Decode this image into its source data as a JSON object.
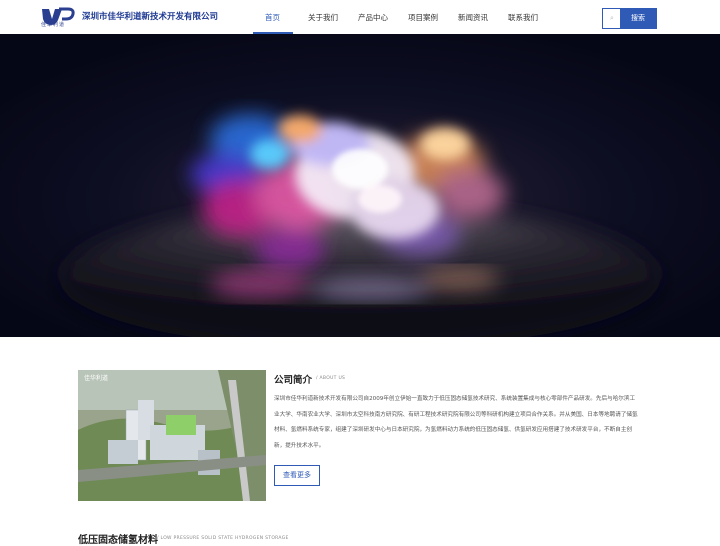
{
  "header": {
    "logo_text": "佳华利道",
    "company_name": "深圳市佳华利道新技术开发有限公司"
  },
  "nav": {
    "items": [
      {
        "label": "首页",
        "active": true
      },
      {
        "label": "关于我们",
        "active": false
      },
      {
        "label": "产品中心",
        "active": false
      },
      {
        "label": "项目案例",
        "active": false
      },
      {
        "label": "新闻资讯",
        "active": false
      },
      {
        "label": "联系我们",
        "active": false
      }
    ]
  },
  "search": {
    "placeholder": "",
    "button_label": "搜索",
    "icon": "search-icon"
  },
  "about": {
    "image_caption": "佳华利道",
    "title": "公司简介",
    "subtitle": "/ ABOUT US",
    "text": "深圳市佳华利道新技术开发有限公司自2009年创立伊始一直致力于低压固态储氢技术研究、系统装置集成与核心零部件产品研发。先后与哈尔滨工业大学、华南农业大学、深圳市太空科技南方研究院、有研工程技术研究院有限公司等科研机构建立项目合作关系。并从美国、日本等地聘请了储氢材料、氢燃料系统专家，组建了深圳研发中心与日本研究院，为氢燃料动力系统的低压固态储氢、供氢研发应用搭建了技术研发平台，不断自主创新，提升技术水平。",
    "more_button": "查看更多"
  },
  "section2": {
    "title": "低压固态储氢材料",
    "subtitle": "/ LOW PRESSURE SOLID STATE HYDROGEN STORAGE"
  },
  "colors": {
    "primary": "#2f5bb7",
    "company": "#1f3a93",
    "banner_bg": "#0a0b1e"
  }
}
